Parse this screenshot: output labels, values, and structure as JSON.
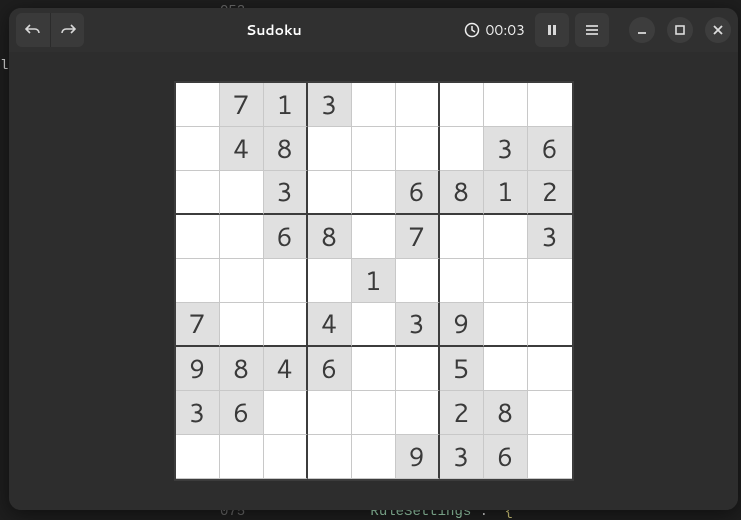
{
  "bg": {
    "line1_num": "052",
    "line2_frag": "la",
    "line3_num": "075",
    "line3_tok1": "\"RuleSettings\"",
    "line3_tok2": ":",
    "line3_tok3": "{"
  },
  "titlebar": {
    "title": "Sudoku",
    "timer": "00:03"
  },
  "icons": {
    "undo": "undo-icon",
    "redo": "redo-icon",
    "clock": "clock-icon",
    "pause": "pause-icon",
    "menu": "hamburger-icon",
    "minimize": "minimize-icon",
    "maximize": "maximize-icon",
    "close": "close-icon"
  },
  "sudoku": {
    "grid": [
      [
        0,
        7,
        1,
        3,
        0,
        0,
        0,
        0,
        0
      ],
      [
        0,
        4,
        8,
        0,
        0,
        0,
        0,
        3,
        6
      ],
      [
        0,
        0,
        3,
        0,
        0,
        6,
        8,
        1,
        2
      ],
      [
        0,
        0,
        6,
        8,
        0,
        7,
        0,
        0,
        3
      ],
      [
        0,
        0,
        0,
        0,
        1,
        0,
        0,
        0,
        0
      ],
      [
        7,
        0,
        0,
        4,
        0,
        3,
        9,
        0,
        0
      ],
      [
        9,
        8,
        4,
        6,
        0,
        0,
        5,
        0,
        0
      ],
      [
        3,
        6,
        0,
        0,
        0,
        0,
        2,
        8,
        0
      ],
      [
        0,
        0,
        0,
        0,
        0,
        9,
        3,
        6,
        0
      ]
    ]
  }
}
